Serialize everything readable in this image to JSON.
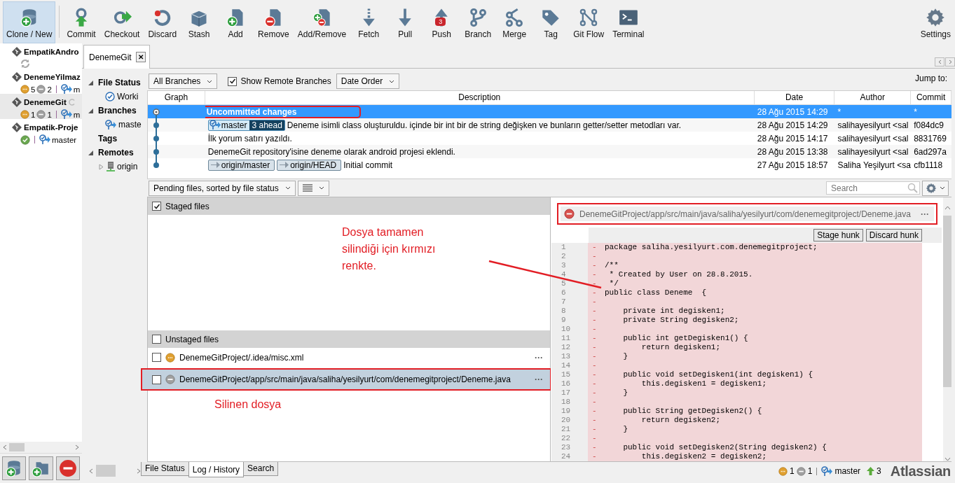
{
  "toolbar": {
    "buttons": [
      {
        "label": "Clone / New",
        "kind": "clone",
        "selected": true
      },
      {
        "label": "Commit",
        "kind": "commit",
        "selected": false
      },
      {
        "label": "Checkout",
        "kind": "checkout",
        "selected": false
      },
      {
        "label": "Discard",
        "kind": "discard",
        "selected": false
      },
      {
        "label": "Stash",
        "kind": "stash",
        "selected": false
      },
      {
        "label": "Add",
        "kind": "add",
        "selected": false
      },
      {
        "label": "Remove",
        "kind": "remove",
        "selected": false
      },
      {
        "label": "Add/Remove",
        "kind": "addremove",
        "selected": false
      },
      {
        "label": "Fetch",
        "kind": "fetch",
        "selected": false
      },
      {
        "label": "Pull",
        "kind": "pull",
        "selected": false
      },
      {
        "label": "Push",
        "kind": "push",
        "badge": "3",
        "selected": false
      },
      {
        "label": "Branch",
        "kind": "branch",
        "selected": false
      },
      {
        "label": "Merge",
        "kind": "merge",
        "selected": false
      },
      {
        "label": "Tag",
        "kind": "tag",
        "selected": false
      },
      {
        "label": "Git Flow",
        "kind": "gitflow",
        "selected": false
      },
      {
        "label": "Terminal",
        "kind": "terminal",
        "selected": false
      },
      {
        "label": "Settings",
        "kind": "settings",
        "selected": false
      }
    ]
  },
  "repos": [
    {
      "name": "EmpatikAndro",
      "selected": false,
      "kind": "syncing"
    },
    {
      "name": "DenemeYilmaz",
      "selected": false,
      "kind": "changes",
      "status": [
        {
          "kind": "modified",
          "count": "5"
        },
        {
          "kind": "removed",
          "count": "2"
        }
      ],
      "branch": "m"
    },
    {
      "name": "DenemeGit",
      "selected": true,
      "kind": "changes",
      "loading": true,
      "status": [
        {
          "kind": "modified",
          "count": "1"
        },
        {
          "kind": "removed",
          "count": "1"
        }
      ],
      "branch": "m"
    },
    {
      "name": "Empatik-Proje",
      "selected": false,
      "kind": "clean",
      "branch": "master"
    }
  ],
  "repo_tab": {
    "label": "DenemeGit",
    "close": "✕"
  },
  "sidebar": [
    {
      "label": "File Status",
      "expanded": true,
      "children": [
        {
          "label": "Worki",
          "kind": "check"
        }
      ]
    },
    {
      "label": "Branches",
      "expanded": true,
      "children": [
        {
          "label": "maste",
          "kind": "branch"
        }
      ]
    },
    {
      "label": "Tags"
    },
    {
      "label": "Remotes",
      "expanded": true,
      "children": [
        {
          "label": "origin",
          "kind": "server",
          "expanded": false
        }
      ]
    }
  ],
  "log": {
    "branch_filter": "All Branches",
    "show_remote": {
      "label": "Show Remote Branches",
      "checked": true
    },
    "order": "Date Order",
    "jump_to": "Jump to:",
    "columns": [
      "Graph",
      "Description",
      "Date",
      "Author",
      "Commit"
    ],
    "rows": [
      {
        "kind": "uncommitted",
        "description": "Uncommitted changes",
        "date": "28 Ağu 2015 14:29",
        "author": "*",
        "commit": "*",
        "selected": true,
        "outlined": true
      },
      {
        "kind": "commit",
        "refs": [
          {
            "kind": "local",
            "label": "master",
            "ahead": "3 ahead"
          }
        ],
        "description": "Deneme isimli class oluşturuldu. içinde bir int bir de string değişken ve bunların getter/setter metodları var.",
        "date": "28 Ağu 2015 14:29",
        "author": "salihayesilyurt <sal",
        "commit": "f084dc9",
        "selected": false,
        "outlined": false
      },
      {
        "kind": "commit",
        "description": "İlk yorum satırı yazıldı.",
        "date": "28 Ağu 2015 14:17",
        "author": "salihayesilyurt <sal",
        "commit": "8831769",
        "selected": false,
        "outlined": false
      },
      {
        "kind": "commit",
        "description": "DenemeGit repository'isine deneme olarak android projesi eklendi.",
        "date": "28 Ağu 2015 13:38",
        "author": "salihayesilyurt <sal",
        "commit": "6ad297a",
        "selected": false,
        "outlined": false
      },
      {
        "kind": "commit",
        "refs": [
          {
            "kind": "remote",
            "label": "origin/master"
          },
          {
            "kind": "remote",
            "label": "origin/HEAD"
          }
        ],
        "description": "Initial commit",
        "date": "27 Ağu 2015 18:57",
        "author": "Saliha Yeşilyurt <sa",
        "commit": "cfb1118",
        "selected": false,
        "outlined": false
      }
    ]
  },
  "files": {
    "filter": "Pending files, sorted by file status",
    "search": {
      "placeholder": "Search"
    },
    "staged": {
      "label": "Staged files",
      "checked": true
    },
    "unstaged": {
      "label": "Unstaged files",
      "checked": false
    },
    "items": [
      {
        "path": "DenemeGitProject/.idea/misc.xml",
        "kind": "modified",
        "checked": false,
        "selected": false,
        "outlined": false,
        "more": "···"
      },
      {
        "path": "DenemeGitProject/app/src/main/java/saliha/yesilyurt/com/denemegitproject/Deneme.java",
        "kind": "removed",
        "checked": false,
        "selected": true,
        "outlined": true,
        "more": "···"
      }
    ]
  },
  "diff": {
    "path": "DenemeGitProject/app/src/main/java/saliha/yesilyurt/com/denemegitproject/Deneme.java",
    "kind": "removed",
    "outlined": true,
    "more": "···",
    "buttons": [
      "Stage hunk",
      "Discard hunk"
    ],
    "lines": [
      {
        "number": "1",
        "sign": "-",
        "text": "package saliha.yesilyurt.com.denemegitproject;"
      },
      {
        "number": "2",
        "sign": "-"
      },
      {
        "number": "3",
        "sign": "-",
        "text": "/**"
      },
      {
        "number": "4",
        "sign": "-",
        "text": " * Created by User on 28.8.2015."
      },
      {
        "number": "5",
        "sign": "-",
        "text": " */"
      },
      {
        "number": "6",
        "sign": "-",
        "text": "public class Deneme  {"
      },
      {
        "number": "7",
        "sign": "-"
      },
      {
        "number": "8",
        "sign": "-",
        "text": "    private int degisken1;"
      },
      {
        "number": "9",
        "sign": "-",
        "text": "    private String degisken2;"
      },
      {
        "number": "10",
        "sign": "-"
      },
      {
        "number": "11",
        "sign": "-",
        "text": "    public int getDegisken1() {"
      },
      {
        "number": "12",
        "sign": "-",
        "text": "        return degisken1;"
      },
      {
        "number": "13",
        "sign": "-",
        "text": "    }"
      },
      {
        "number": "14",
        "sign": "-"
      },
      {
        "number": "15",
        "sign": "-",
        "text": "    public void setDegisken1(int degisken1) {"
      },
      {
        "number": "16",
        "sign": "-",
        "text": "        this.degisken1 = degisken1;"
      },
      {
        "number": "17",
        "sign": "-",
        "text": "    }"
      },
      {
        "number": "18",
        "sign": "-"
      },
      {
        "number": "19",
        "sign": "-",
        "text": "    public String getDegisken2() {"
      },
      {
        "number": "20",
        "sign": "-",
        "text": "        return degisken2;"
      },
      {
        "number": "21",
        "sign": "-",
        "text": "    }"
      },
      {
        "number": "22",
        "sign": "-"
      },
      {
        "number": "23",
        "sign": "-",
        "text": "    public void setDegisken2(String degisken2) {"
      },
      {
        "number": "24",
        "sign": "-",
        "text": "        this.degisken2 = degisken2;"
      }
    ]
  },
  "bottom_tabs": [
    {
      "label": "File Status",
      "selected": false
    },
    {
      "label": "Log / History",
      "selected": true
    },
    {
      "label": "Search",
      "selected": false
    }
  ],
  "status_bar": {
    "status": [
      {
        "kind": "modified",
        "count": "1"
      },
      {
        "kind": "removed",
        "count": "1"
      }
    ],
    "branch": "master",
    "ahead": "3",
    "logo": "Atlassian"
  },
  "annotations": [
    {
      "kind": "note",
      "text": "Dosya tamamen silindiği için kırmızı renkte."
    },
    {
      "kind": "note",
      "text": "Silinen dosya"
    },
    {
      "kind": "leader"
    }
  ]
}
